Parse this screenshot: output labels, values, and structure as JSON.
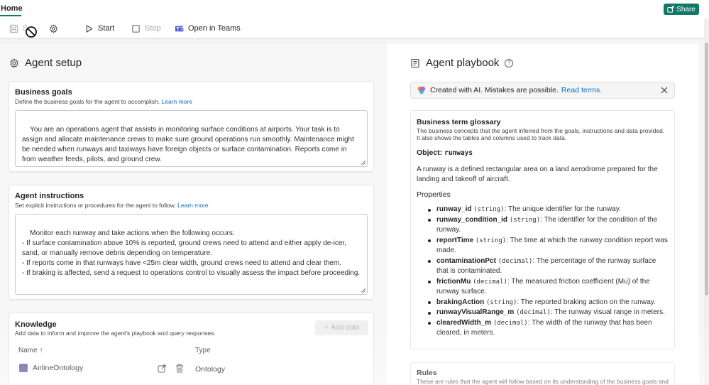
{
  "topbar": {
    "home_tab": "Home",
    "share_label": "Share"
  },
  "toolbar": {
    "save_label": "S",
    "start_label": "Start",
    "stop_label": "Stop",
    "teams_label": "Open in Teams"
  },
  "setup": {
    "title": "Agent setup",
    "business_goals": {
      "title": "Business goals",
      "subtitle": "Define the business goals for the agent to accomplish.",
      "link": "Learn more",
      "text": "You are an operations agent that assists in monitoring surface conditions at airports. Your task is to assign and allocate maintenance crews to make sure ground operations run smoothly. Maintenance might be needed when runways and taxiways have foreign objects or surface contamination. Reports come in from weather feeds, pilots, and ground crew."
    },
    "instructions": {
      "title": "Agent instructions",
      "subtitle": "Set explicit instructions or procedures for the agent to follow.",
      "link": "Learn more",
      "text": "Monitor each runway and take actions when the following occurs:\n- If surface contamination above 10% is reported, ground crews need to attend and either apply de-icer, sand, or manually remove debris depending on temperature.\n- If reports come in that runways have <25m clear width, ground crews need to attend and clear them.\n- If braking is affected, send a request to operations control to visually assess the impact before proceeding."
    },
    "knowledge": {
      "title": "Knowledge",
      "subtitle": "Add data to inform and improve the agent's playbook and query responses.",
      "add_data_label": "Add data",
      "col_name": "Name ↑",
      "col_type": "Type",
      "rows": [
        {
          "name": "AirlineOntology",
          "type": "Ontology"
        }
      ]
    }
  },
  "playbook": {
    "title": "Agent playbook",
    "help": "?",
    "ai_banner": {
      "text": "Created with AI. Mistakes are possible.",
      "link": "Read terms."
    },
    "glossary": {
      "title": "Business term glossary",
      "subtitle": "The business concepts that the agent inferred from the goals, instructions and data provided. It also shows the tables and columns used to track data.",
      "object_label": "Object:",
      "object_name": "runways",
      "description": "A runway is a defined rectangular area on a land aerodrome prepared for the landing and takeoff of aircraft.",
      "properties_label": "Properties",
      "properties": [
        {
          "name": "runway_id",
          "type": "(string)",
          "desc": ": The unique identifier for the runway."
        },
        {
          "name": "runway_condition_id",
          "type": "(string)",
          "desc": ": The identifier for the condition of the runway."
        },
        {
          "name": "reportTime",
          "type": "(string)",
          "desc": ": The time at which the runway condition report was made."
        },
        {
          "name": "contaminationPct",
          "type": "(decimal)",
          "desc": ": The percentage of the runway surface that is contaminated."
        },
        {
          "name": "frictionMu",
          "type": "(decimal)",
          "desc": ": The measured friction coefficient (Mu) of the runway surface."
        },
        {
          "name": "brakingAction",
          "type": "(string)",
          "desc": ": The reported braking action on the runway."
        },
        {
          "name": "runwayVisualRange_m",
          "type": "(decimal)",
          "desc": ": The runway visual range in meters."
        },
        {
          "name": "clearedWidth_m",
          "type": "(decimal)",
          "desc": ": The width of the runway that has been cleared, in meters."
        }
      ]
    },
    "rules": {
      "title": "Rules",
      "subtitle": "These are rules that the agent will follow based on its understanding of the business goals and"
    }
  },
  "colors": {
    "accent": "#117865",
    "link": "#0f6cbd",
    "teams": "#5059c9"
  }
}
